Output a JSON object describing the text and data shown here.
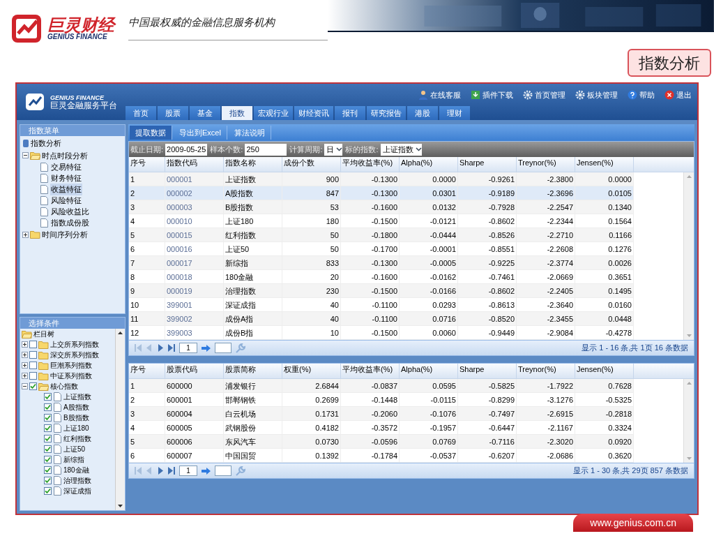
{
  "header": {
    "logo_cn": "巨灵财经",
    "logo_en": "GENIUS FINANCE",
    "slogan": "中国最权威的金融信息服务机构"
  },
  "page_badge": "指数分析",
  "app": {
    "brand_en": "GENIUS FINANCE",
    "brand_cn": "巨灵金融服务平台",
    "links": [
      {
        "kind": "user",
        "label": "在线客服"
      },
      {
        "kind": "download",
        "label": "插件下载"
      },
      {
        "kind": "gear",
        "label": "首页管理"
      },
      {
        "kind": "gear",
        "label": "板块管理"
      },
      {
        "kind": "help",
        "label": "帮助"
      },
      {
        "kind": "exit",
        "label": "退出"
      }
    ],
    "tabs": [
      {
        "label": "首页",
        "selected": false
      },
      {
        "label": "股票",
        "selected": false
      },
      {
        "label": "基金",
        "selected": false
      },
      {
        "label": "指数",
        "selected": true
      },
      {
        "label": "宏观行业",
        "selected": false
      },
      {
        "label": "财经资讯",
        "selected": false
      },
      {
        "label": "报刊",
        "selected": false
      },
      {
        "label": "研究报告",
        "selected": false
      },
      {
        "label": "港股",
        "selected": false
      },
      {
        "label": "理财",
        "selected": false
      }
    ]
  },
  "menu": {
    "title": "指数菜单",
    "root": "指数分析",
    "items": [
      {
        "label": "时点时段分析",
        "expanded": true,
        "children": [
          {
            "label": "交易特征",
            "selected": false
          },
          {
            "label": "财务特征",
            "selected": false
          },
          {
            "label": "收益特征",
            "selected": true
          },
          {
            "label": "风险特征",
            "selected": false
          },
          {
            "label": "风险收益比",
            "selected": false
          },
          {
            "label": "指数成份股",
            "selected": false
          }
        ]
      },
      {
        "label": "时间序列分析",
        "expanded": false
      }
    ]
  },
  "conditions": {
    "title": "选择条件",
    "root": "栏目树",
    "items": [
      {
        "label": "上交所系列指数",
        "checked": false,
        "expanded": false
      },
      {
        "label": "深交所系列指数",
        "checked": false,
        "expanded": false
      },
      {
        "label": "巨潮系列指数",
        "checked": false,
        "expanded": false
      },
      {
        "label": "中证系列指数",
        "checked": false,
        "expanded": false
      },
      {
        "label": "核心指数",
        "checked": true,
        "expanded": true,
        "children": [
          {
            "label": "上证指数",
            "checked": true
          },
          {
            "label": "A股指数",
            "checked": true
          },
          {
            "label": "B股指数",
            "checked": true
          },
          {
            "label": "上证180",
            "checked": true
          },
          {
            "label": "红利指数",
            "checked": true
          },
          {
            "label": "上证50",
            "checked": true
          },
          {
            "label": "新综指",
            "checked": true
          },
          {
            "label": "180金融",
            "checked": true
          },
          {
            "label": "治理指数",
            "checked": true
          },
          {
            "label": "深证成指",
            "checked": true
          }
        ]
      }
    ]
  },
  "toolbar": [
    {
      "label": "提取数据",
      "selected": true
    },
    {
      "label": "导出到Excel",
      "selected": false
    },
    {
      "label": "算法说明",
      "selected": false
    }
  ],
  "filters": [
    {
      "kind": "input",
      "label": "截止日期:",
      "value": "2009-05-25"
    },
    {
      "kind": "input",
      "label": "样本个数:",
      "value": "250"
    },
    {
      "kind": "select",
      "label": "计算周期:",
      "value": "日"
    },
    {
      "kind": "select",
      "label": "标的指数:",
      "value": "上证指数"
    }
  ],
  "index_table": {
    "columns": [
      "序号",
      "指数代码",
      "指数名称",
      "成份个数",
      "平均收益率(%)",
      "Alpha(%)",
      "Sharpe",
      "Treynor(%)",
      "Jensen(%)"
    ],
    "rows": [
      {
        "selected": false,
        "cells": [
          "1",
          "000001",
          "上证指数",
          "900",
          "-0.1300",
          "0.0000",
          "-0.9261",
          "-2.3800",
          "0.0000"
        ]
      },
      {
        "selected": true,
        "cells": [
          "2",
          "000002",
          "A股指数",
          "847",
          "-0.1300",
          "0.0301",
          "-0.9189",
          "-2.3696",
          "0.0105"
        ]
      },
      {
        "selected": false,
        "cells": [
          "3",
          "000003",
          "B股指数",
          "53",
          "-0.1600",
          "0.0132",
          "-0.7928",
          "-2.2547",
          "0.1340"
        ]
      },
      {
        "selected": false,
        "cells": [
          "4",
          "000010",
          "上证180",
          "180",
          "-0.1500",
          "-0.0121",
          "-0.8602",
          "-2.2344",
          "0.1564"
        ]
      },
      {
        "selected": false,
        "cells": [
          "5",
          "000015",
          "红利指数",
          "50",
          "-0.1800",
          "-0.0444",
          "-0.8526",
          "-2.2710",
          "0.1166"
        ]
      },
      {
        "selected": false,
        "cells": [
          "6",
          "000016",
          "上证50",
          "50",
          "-0.1700",
          "-0.0001",
          "-0.8551",
          "-2.2608",
          "0.1276"
        ]
      },
      {
        "selected": false,
        "cells": [
          "7",
          "000017",
          "新综指",
          "833",
          "-0.1300",
          "-0.0005",
          "-0.9225",
          "-2.3774",
          "0.0026"
        ]
      },
      {
        "selected": false,
        "cells": [
          "8",
          "000018",
          "180金融",
          "20",
          "-0.1600",
          "-0.0162",
          "-0.7461",
          "-2.0669",
          "0.3651"
        ]
      },
      {
        "selected": false,
        "cells": [
          "9",
          "000019",
          "治理指数",
          "230",
          "-0.1500",
          "-0.0166",
          "-0.8602",
          "-2.2405",
          "0.1495"
        ]
      },
      {
        "selected": false,
        "cells": [
          "10",
          "399001",
          "深证成指",
          "40",
          "-0.1100",
          "0.0293",
          "-0.8613",
          "-2.3640",
          "0.0160"
        ]
      },
      {
        "selected": false,
        "cells": [
          "11",
          "399002",
          "成份A指",
          "40",
          "-0.1100",
          "0.0716",
          "-0.8520",
          "-2.3455",
          "0.0448"
        ]
      },
      {
        "selected": false,
        "cells": [
          "12",
          "399003",
          "成份B指",
          "10",
          "-0.1500",
          "0.0060",
          "-0.9449",
          "-2.9084",
          "-0.4278"
        ]
      }
    ],
    "pager": {
      "page": "1",
      "status": "显示 1 - 16 条,共 1页 16 条数据"
    }
  },
  "stock_table": {
    "columns": [
      "序号",
      "股票代码",
      "股票简称",
      "权重(%)",
      "平均收益率(%)",
      "Alpha(%)",
      "Sharpe",
      "Treynor(%)",
      "Jensen(%)"
    ],
    "rows": [
      {
        "selected": false,
        "cells": [
          "1",
          "600000",
          "浦发银行",
          "2.6844",
          "-0.0837",
          "0.0595",
          "-0.5825",
          "-1.7922",
          "0.7628"
        ]
      },
      {
        "selected": false,
        "cells": [
          "2",
          "600001",
          "邯郸钢铁",
          "0.2699",
          "-0.1448",
          "-0.0115",
          "-0.8299",
          "-3.1276",
          "-0.5325"
        ]
      },
      {
        "selected": false,
        "cells": [
          "3",
          "600004",
          "白云机场",
          "0.1731",
          "-0.2060",
          "-0.1076",
          "-0.7497",
          "-2.6915",
          "-0.2818"
        ]
      },
      {
        "selected": false,
        "cells": [
          "4",
          "600005",
          "武钢股份",
          "0.4182",
          "-0.3572",
          "-0.1957",
          "-0.6447",
          "-2.1167",
          "0.3324"
        ]
      },
      {
        "selected": false,
        "cells": [
          "5",
          "600006",
          "东风汽车",
          "0.0730",
          "-0.0596",
          "0.0769",
          "-0.7116",
          "-2.3020",
          "0.0920"
        ]
      },
      {
        "selected": false,
        "cells": [
          "6",
          "600007",
          "中国国贸",
          "0.1392",
          "-0.1784",
          "-0.0537",
          "-0.6207",
          "-2.0686",
          "0.3620"
        ]
      }
    ],
    "pager": {
      "page": "1",
      "status": "显示 1 - 30 条,共 29页 857 条数据"
    }
  },
  "footer": {
    "url": "www.genius.com.cn"
  }
}
